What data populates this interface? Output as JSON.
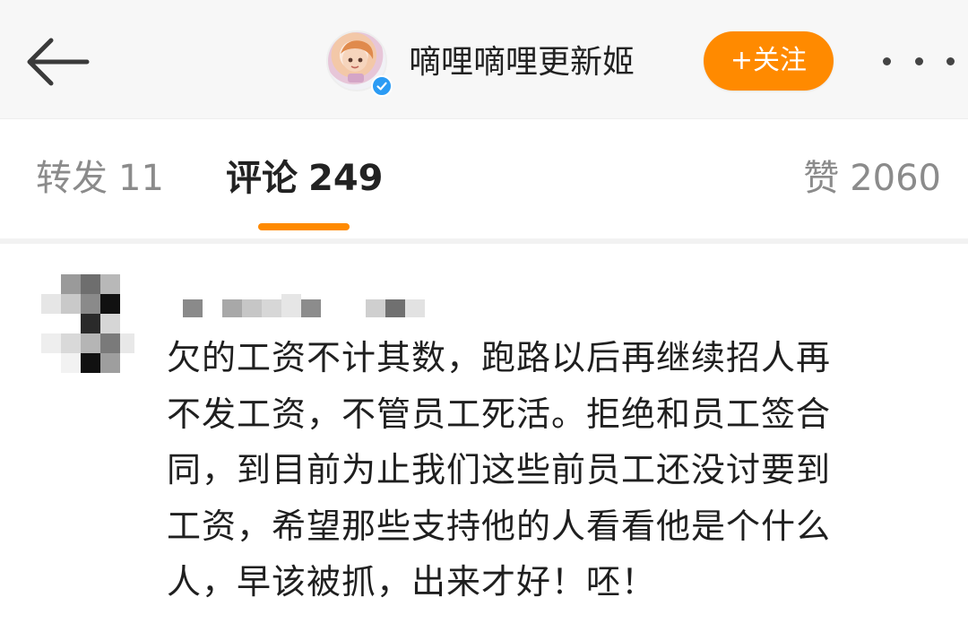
{
  "header": {
    "back_icon": "arrow-left-icon",
    "username": "嘀哩嘀哩更新姬",
    "verified_icon": "verified-check-icon",
    "follow_label": "+关注",
    "more_icon": "more-dots-icon",
    "accent_color": "#ff8a00",
    "verified_color": "#2b9bf4"
  },
  "tabs": [
    {
      "label": "转发",
      "count": "11",
      "active": false
    },
    {
      "label": "评论",
      "count": "249",
      "active": true
    },
    {
      "label": "赞",
      "count": "2060",
      "active": false
    }
  ],
  "comment": {
    "avatar": "pixelated-avatar",
    "name": "",
    "text_lines": [
      "欠的工资不计其数，跑路以后再继续招人再",
      "不发工资，不管员工死活。拒绝和员工签合",
      "同，到目前为止我们这些前员工还没讨要到",
      "工资，希望那些支持他的人看看他是个什么",
      "人，早该被抓，出来才好！呸！"
    ]
  }
}
